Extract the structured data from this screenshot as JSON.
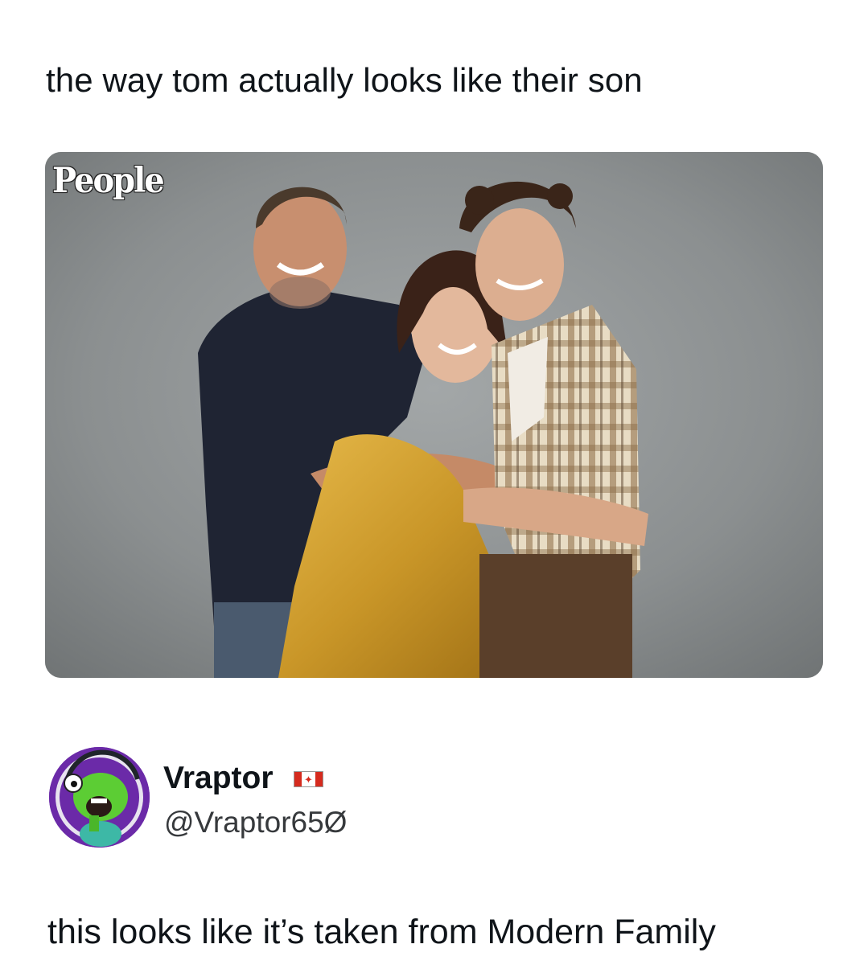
{
  "post": {
    "caption": "the way tom actually looks like their son",
    "image": {
      "watermark": "People",
      "description_icon": "photo-image"
    }
  },
  "reply": {
    "display_name": "Vraptor",
    "badge_icon": "canada-flag-icon",
    "badge_glyph": "✦",
    "handle": "@Vraptor65Ø",
    "text": "this looks like it’s taken from Modern Family"
  },
  "colors": {
    "text": "#0f1419",
    "handle": "#36393c",
    "background": "#ffffff",
    "avatar_bg": "#6b2aa8",
    "flag_red": "#d52b1e"
  }
}
